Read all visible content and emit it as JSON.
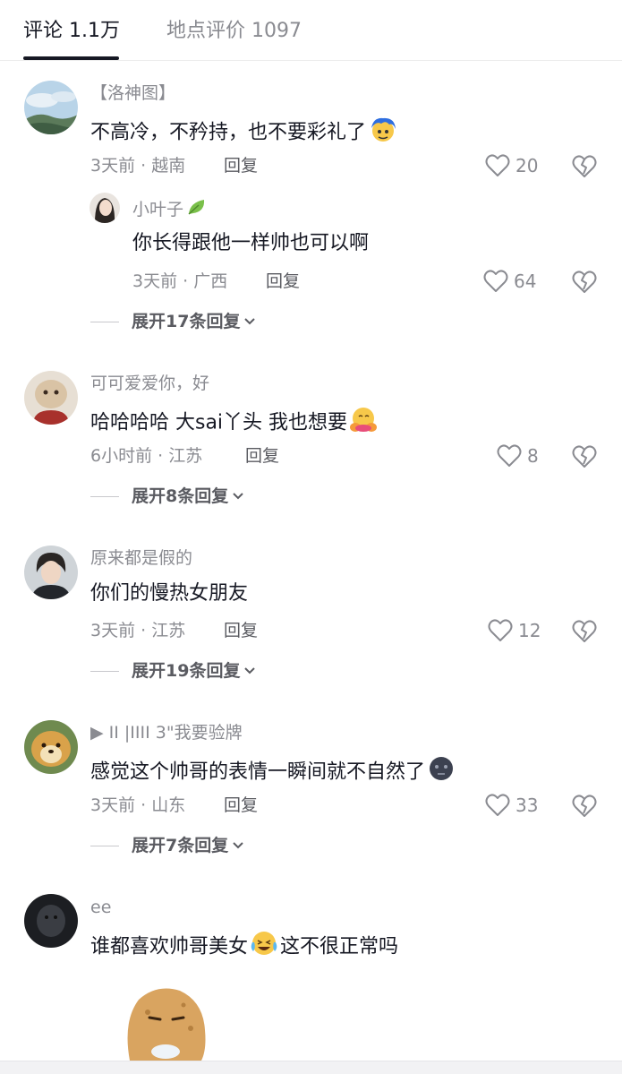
{
  "tabs": {
    "comments_label": "评论 1.1万",
    "reviews_label": "地点评价 1097"
  },
  "reply_label": "回复",
  "comments": [
    {
      "username": "【洛神图】",
      "text": "不高冷，不矜持，也不要彩礼了",
      "emoji": "blue-hair-face-emoji",
      "time_location": "3天前 · 越南",
      "likes": "20",
      "reply": {
        "username": "小叶子",
        "badge": "leaf-icon",
        "text": "你长得跟他一样帅也可以啊",
        "time_location": "3天前 · 广西",
        "likes": "64"
      },
      "expand_label": "展开17条回复"
    },
    {
      "username": "可可爱爱你，好",
      "text": "哈哈哈哈 大sai丫头 我也想要",
      "emoji": "hugging-face-emoji",
      "time_location": "6小时前 · 江苏",
      "likes": "8",
      "expand_label": "展开8条回复"
    },
    {
      "username": "原来都是假的",
      "text": "你们的慢热女朋友",
      "time_location": "3天前 · 江苏",
      "likes": "12",
      "expand_label": "展开19条回复"
    },
    {
      "username": "▶ ІІ |ІІІІ 3\"我要验牌",
      "text": "感觉这个帅哥的表情一瞬间就不自然了",
      "emoji": "dark-face-emoji",
      "time_location": "3天前 · 山东",
      "likes": "33",
      "expand_label": "展开7条回复"
    },
    {
      "username": "ee",
      "text_before": "谁都喜欢帅哥美女",
      "emoji": "laughing-crying-emoji",
      "text_after": "这不很正常吗",
      "sticker": "potato-sticker"
    }
  ],
  "colors": {
    "text_primary": "#161823",
    "text_secondary": "#8a8b91",
    "divider": "#ececec"
  }
}
